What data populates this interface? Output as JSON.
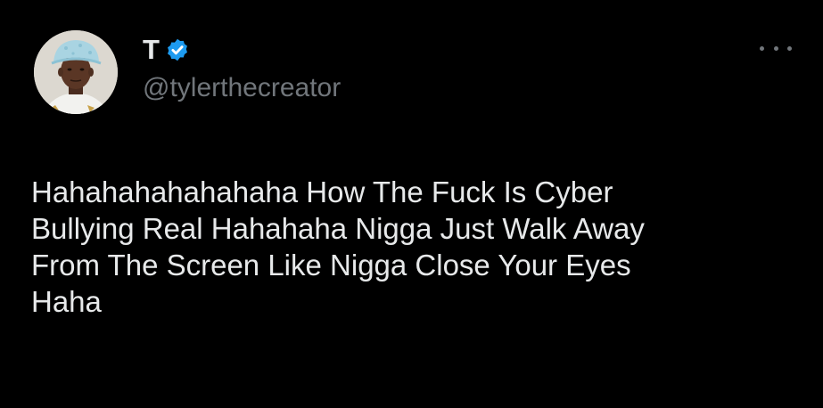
{
  "tweet": {
    "author": {
      "display_name": "T",
      "handle": "@tylerthecreator",
      "verified": true,
      "avatar_icon": "profile-photo"
    },
    "more_icon": "more-horizontal-icon",
    "text": "Hahahahahahahaha How The Fuck Is Cyber\nBullying Real Hahahaha Nigga Just Walk Away\nFrom The Screen Like Nigga Close Your Eyes\nHaha"
  },
  "colors": {
    "background": "#000000",
    "primary_text": "#e7e9ea",
    "secondary_text": "#71767b",
    "verified_badge": "#1d9bf0"
  }
}
